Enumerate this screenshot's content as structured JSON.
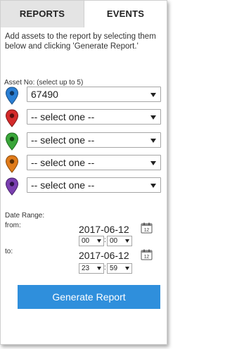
{
  "tabs": [
    {
      "label": "REPORTS"
    },
    {
      "label": "EVENTS"
    }
  ],
  "instructions": "Add assets to the report by selecting them below and clicking 'Generate Report.'",
  "asset_label": "Asset No: (select up to 5)",
  "assets": [
    {
      "value": "67490",
      "color": "#2a7fd4",
      "icon": "blue-map-pin-icon"
    },
    {
      "value": "-- select one --",
      "color": "#d42a2a",
      "icon": "red-map-pin-icon"
    },
    {
      "value": "-- select one --",
      "color": "#3aa63a",
      "icon": "green-map-pin-icon"
    },
    {
      "value": "-- select one --",
      "color": "#e07b1a",
      "icon": "orange-map-pin-icon"
    },
    {
      "value": "-- select one --",
      "color": "#7a3fb0",
      "icon": "purple-map-pin-icon"
    }
  ],
  "date_range": {
    "label": "Date Range:",
    "from_label": "from:",
    "to_label": "to:",
    "from_date": "2017-06-12",
    "to_date": "2017-06-12",
    "from_hour": "00",
    "from_minute": "00",
    "to_hour": "23",
    "to_minute": "59",
    "colon": ":"
  },
  "generate_button": "Generate Report",
  "accent_color": "#2f8fdc"
}
